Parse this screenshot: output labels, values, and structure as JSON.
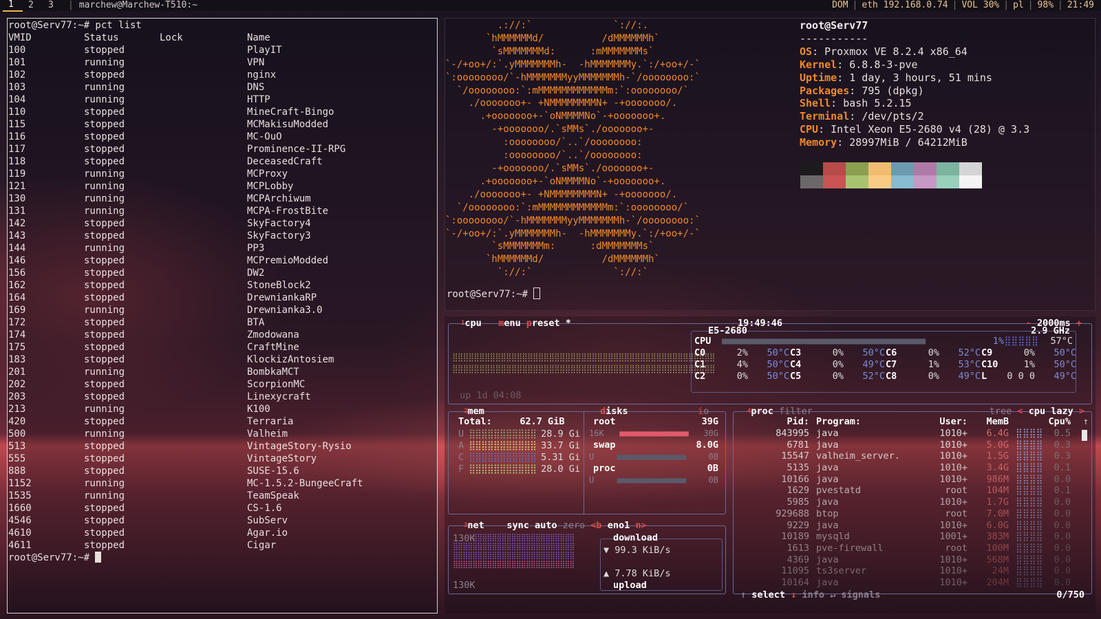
{
  "topbar": {
    "workspaces": [
      "1",
      "2",
      "3"
    ],
    "active_workspace": "1",
    "window_title": "marchew@Marchew-T510:~",
    "status": [
      "DOM",
      "eth 192.168.0.74",
      "VOL 30%",
      "pl",
      "98%",
      "21:49"
    ]
  },
  "left_terminal": {
    "command_line": "root@Serv77:~# pct list",
    "headers": [
      "VMID",
      "Status",
      "Lock",
      "Name"
    ],
    "rows": [
      [
        "100",
        "stopped",
        "",
        "PlayIT"
      ],
      [
        "101",
        "running",
        "",
        "VPN"
      ],
      [
        "102",
        "stopped",
        "",
        "nginx"
      ],
      [
        "103",
        "running",
        "",
        "DNS"
      ],
      [
        "104",
        "running",
        "",
        "HTTP"
      ],
      [
        "110",
        "stopped",
        "",
        "MineCraft-Bingo"
      ],
      [
        "115",
        "stopped",
        "",
        "MCMakisuModded"
      ],
      [
        "116",
        "stopped",
        "",
        "MC-OuO"
      ],
      [
        "117",
        "stopped",
        "",
        "Prominence-II-RPG"
      ],
      [
        "118",
        "stopped",
        "",
        "DeceasedCraft"
      ],
      [
        "119",
        "running",
        "",
        "MCProxy"
      ],
      [
        "121",
        "running",
        "",
        "MCPLobby"
      ],
      [
        "130",
        "running",
        "",
        "MCPArchiwum"
      ],
      [
        "131",
        "running",
        "",
        "MCPA-FrostBite"
      ],
      [
        "142",
        "stopped",
        "",
        "SkyFactory4"
      ],
      [
        "143",
        "stopped",
        "",
        "SkyFactory3"
      ],
      [
        "144",
        "running",
        "",
        "PP3"
      ],
      [
        "146",
        "stopped",
        "",
        "MCPremioModded"
      ],
      [
        "156",
        "stopped",
        "",
        "DW2"
      ],
      [
        "162",
        "stopped",
        "",
        "StoneBlock2"
      ],
      [
        "164",
        "stopped",
        "",
        "DrewniankaRP"
      ],
      [
        "169",
        "running",
        "",
        "Drewnianka3.0"
      ],
      [
        "172",
        "stopped",
        "",
        "BTA"
      ],
      [
        "174",
        "stopped",
        "",
        "Zmodowana"
      ],
      [
        "175",
        "stopped",
        "",
        "CraftMine"
      ],
      [
        "183",
        "stopped",
        "",
        "KlockizAntosiem"
      ],
      [
        "201",
        "running",
        "",
        "BombkaMCT"
      ],
      [
        "202",
        "stopped",
        "",
        "ScorpionMC"
      ],
      [
        "203",
        "stopped",
        "",
        "Linexycraft"
      ],
      [
        "213",
        "running",
        "",
        "K100"
      ],
      [
        "420",
        "stopped",
        "",
        "Terraria"
      ],
      [
        "500",
        "running",
        "",
        "Valheim"
      ],
      [
        "513",
        "stopped",
        "",
        "VintageStory-Rysio"
      ],
      [
        "555",
        "stopped",
        "",
        "VintageStory"
      ],
      [
        "888",
        "stopped",
        "",
        "SUSE-15.6"
      ],
      [
        "1152",
        "running",
        "",
        "MC-1.5.2-BungeeCraft"
      ],
      [
        "1535",
        "running",
        "",
        "TeamSpeak"
      ],
      [
        "1660",
        "stopped",
        "",
        "CS-1.6"
      ],
      [
        "4546",
        "stopped",
        "",
        "SubServ"
      ],
      [
        "4610",
        "stopped",
        "",
        "Agar.io"
      ],
      [
        "4611",
        "stopped",
        "",
        "Cigar"
      ]
    ],
    "prompt": "root@Serv77:~# "
  },
  "neofetch": {
    "title": "root@Serv77",
    "dashes": "-----------",
    "fields": [
      {
        "key": "OS",
        "value": "Proxmox VE 8.2.4 x86_64"
      },
      {
        "key": "Kernel",
        "value": "6.8.8-3-pve"
      },
      {
        "key": "Uptime",
        "value": "1 day, 3 hours, 51 mins"
      },
      {
        "key": "Packages",
        "value": "795 (dpkg)"
      },
      {
        "key": "Shell",
        "value": "bash 5.2.15"
      },
      {
        "key": "Terminal",
        "value": "/dev/pts/2"
      },
      {
        "key": "CPU",
        "value": "Intel Xeon E5-2680 v4 (28) @ 3.3"
      },
      {
        "key": "Memory",
        "value": "28997MiB / 64212MiB"
      }
    ],
    "palette": [
      "#1c1a1c",
      "#b84a4a",
      "#8aa050",
      "#f0bc70",
      "#6c9ab0",
      "#b07aa8",
      "#7cb4a0",
      "#d4d4d4",
      "#6a6868",
      "#c85454",
      "#a8c470",
      "#f8cc84",
      "#88bcd0",
      "#c898c4",
      "#98d0bc",
      "#f4f4f4"
    ],
    "prompt": "root@Serv77:~# "
  },
  "btop": {
    "cpu_box": {
      "tabs": [
        {
          "num": "1",
          "label": "cpu"
        },
        {
          "num": "",
          "label": "menu"
        },
        {
          "num": "",
          "label": "preset *"
        }
      ],
      "clock": "19:49:46",
      "interval": "2000ms",
      "model": "E5-2680",
      "freq": "2.9 GHz",
      "total_label": "CPU",
      "total_pct": "1%",
      "total_temp": "57°C",
      "uptime": "up 1d 04:08",
      "cores": [
        [
          {
            "n": "C0",
            "p": "2%",
            "t": "50°C"
          },
          {
            "n": "C3",
            "p": "0%",
            "t": "50°C"
          },
          {
            "n": "C6",
            "p": "0%",
            "t": "52°C"
          },
          {
            "n": "C9",
            "p": "0%",
            "t": "50°C"
          }
        ],
        [
          {
            "n": "C1",
            "p": "4%",
            "t": "50°C"
          },
          {
            "n": "C4",
            "p": "0%",
            "t": "49°C"
          },
          {
            "n": "C7",
            "p": "1%",
            "t": "53°C"
          },
          {
            "n": "C10",
            "p": "1%",
            "t": "50°C"
          }
        ],
        [
          {
            "n": "C2",
            "p": "0%",
            "t": "50°C"
          },
          {
            "n": "C5",
            "p": "0%",
            "t": "52°C"
          },
          {
            "n": "C8",
            "p": "0%",
            "t": "49°C"
          },
          {
            "n": "L",
            "p": "0 0 0",
            "t": "49°C"
          }
        ]
      ]
    },
    "mem_box": {
      "title_num": "2",
      "title": "mem",
      "disks_title": "disks",
      "io_label": "io",
      "total_label": "Total:",
      "total_value": "62.7 GiB",
      "rows": [
        {
          "k": "U",
          "v": "28.9 Gi",
          "color": "#9a9a6a"
        },
        {
          "k": "A",
          "v": "33.7 Gi",
          "color": "#d8c070"
        },
        {
          "k": "C",
          "v": "5.31 Gi",
          "color": "#6a6aaa"
        },
        {
          "k": "F",
          "v": "28.0 Gi",
          "color": "#b0c070"
        }
      ],
      "disks": [
        {
          "name": "root",
          "size": "39G",
          "u": "16K",
          "free": "30G"
        },
        {
          "name": "swap",
          "size": "8.0G",
          "u": "U",
          "free": "0B"
        },
        {
          "name": "proc",
          "size": "0B",
          "u": "U",
          "free": "0B"
        }
      ]
    },
    "net_box": {
      "title_num": "3",
      "title": "net",
      "sync": "sync",
      "auto": "auto",
      "zero": "zero",
      "iface_prefix": "<b",
      "iface": "eno1",
      "iface_suffix": "n>",
      "scale_top": "130K",
      "scale_bottom": "130K",
      "download_label": "download",
      "download_value": "99.3 KiB/s",
      "upload_value": "7.78 KiB/s",
      "upload_label": "upload"
    },
    "proc_box": {
      "title_num": "4",
      "title": "proc",
      "filter": "filter",
      "tree": "tree",
      "sort": "cpu lazy",
      "headers": [
        "Pid:",
        "Program:",
        "User:",
        "MemB",
        "Cpu%"
      ],
      "rows": [
        [
          "843995",
          "java",
          "1010+",
          "6.4G",
          "0.5"
        ],
        [
          "6781",
          "java",
          "1010+",
          "5.0G",
          "0.3"
        ],
        [
          "15547",
          "valheim_server.",
          "1010+",
          "1.5G",
          "0.3"
        ],
        [
          "5135",
          "java",
          "1010+",
          "3.4G",
          "0.1"
        ],
        [
          "10166",
          "java",
          "1010+",
          "986M",
          "0.0"
        ],
        [
          "1629",
          "pvestatd",
          "root",
          "104M",
          "0.1"
        ],
        [
          "5985",
          "java",
          "1010+",
          "1.7G",
          "0.0"
        ],
        [
          "929688",
          "btop",
          "root",
          "7.0M",
          "0.0"
        ],
        [
          "9229",
          "java",
          "1010+",
          "6.0G",
          "0.0"
        ],
        [
          "10189",
          "mysqld",
          "1001+",
          "383M",
          "0.0"
        ],
        [
          "1613",
          "pve-firewall",
          "root",
          "100M",
          "0.0"
        ],
        [
          "4369",
          "java",
          "1010+",
          "568M",
          "0.0"
        ],
        [
          "11095",
          "ts3server",
          "1010+",
          "24M",
          "0.0"
        ],
        [
          "10164",
          "java",
          "1010+",
          "204M",
          "0.0"
        ]
      ],
      "footer_select": "select",
      "footer_info": "info",
      "footer_signals": "signals",
      "count": "0/750"
    }
  }
}
